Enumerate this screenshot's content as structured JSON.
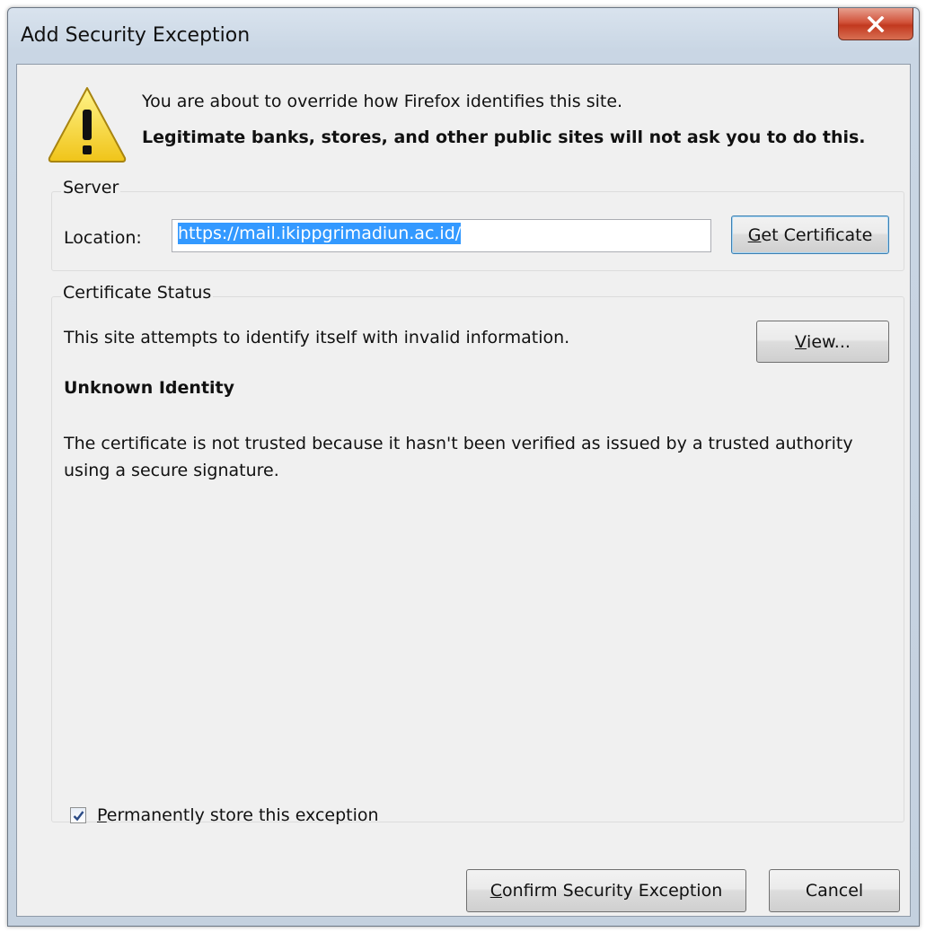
{
  "window": {
    "title": "Add Security Exception"
  },
  "intro": {
    "line1": "You are about to override how Firefox identifies this site.",
    "line2": "Legitimate banks, stores, and other public sites will not ask you to do this.",
    "icon": "warning-icon"
  },
  "server": {
    "group_label": "Server",
    "location_label": "Location:",
    "location_value": "https://mail.ikippgrimadiun.ac.id/",
    "get_certificate": {
      "mnemonic": "G",
      "rest": "et Certificate"
    }
  },
  "certificate_status": {
    "group_label": "Certificate Status",
    "summary": "This site attempts to identify itself with invalid information.",
    "view_button": {
      "mnemonic": "V",
      "rest": "iew..."
    },
    "heading": "Unknown Identity",
    "description": "The certificate is not trusted because it hasn't been verified as issued by a trusted authority using a secure signature."
  },
  "permanent": {
    "checked": true,
    "mnemonic": "P",
    "rest": "ermanently store this exception"
  },
  "buttons": {
    "confirm": {
      "mnemonic": "C",
      "rest": "onfirm Security Exception"
    },
    "cancel": "Cancel"
  },
  "colors": {
    "selection": "#3399ff",
    "close_button": "#c2391f",
    "dialog_bg": "#f0f0f0"
  }
}
